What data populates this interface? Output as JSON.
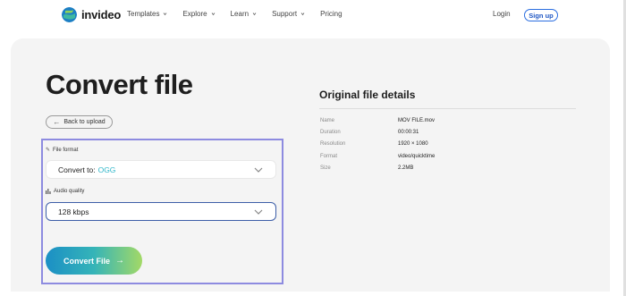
{
  "header": {
    "brand": "invideo",
    "nav": [
      {
        "label": "Templates",
        "has_dropdown": true
      },
      {
        "label": "Explore",
        "has_dropdown": true
      },
      {
        "label": "Learn",
        "has_dropdown": true
      },
      {
        "label": "Support",
        "has_dropdown": true
      },
      {
        "label": "Pricing",
        "has_dropdown": false
      }
    ],
    "login_label": "Login",
    "signup_label": "Sign up"
  },
  "main": {
    "title": "Convert file",
    "back_label": "Back to upload",
    "format": {
      "label": "File format",
      "icon": "pencil-icon",
      "prefix": "Convert to:",
      "value": "OGG"
    },
    "audio": {
      "label": "Audio quality",
      "icon": "bars-icon",
      "value": "128 kbps"
    },
    "convert_label": "Convert File"
  },
  "details": {
    "title": "Original file details",
    "rows": [
      {
        "key": "Name",
        "value": "MOV FILE.mov"
      },
      {
        "key": "Duration",
        "value": "00:00:31"
      },
      {
        "key": "Resolution",
        "value": "1920 × 1080"
      },
      {
        "key": "Format",
        "value": "video/quicktime"
      },
      {
        "key": "Size",
        "value": "2.2MB"
      }
    ]
  },
  "colors": {
    "accent": "#2a6de0",
    "format_value": "#2fb6c9",
    "highlight_border": "#8d8be0",
    "gradient": [
      "#1b8fc5",
      "#35b4b8",
      "#a3d966"
    ]
  }
}
